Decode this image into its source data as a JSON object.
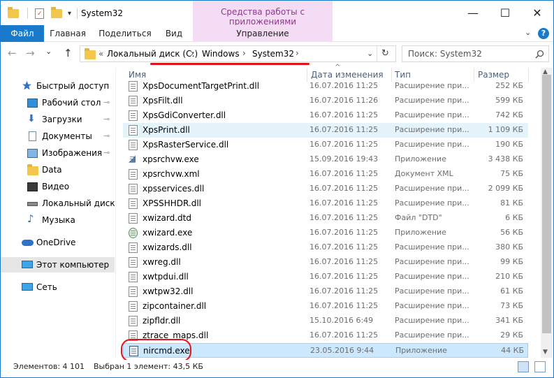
{
  "window": {
    "title": "System32",
    "context_tab_title": "Средства работы с приложениями",
    "min_glyph": "—",
    "max_glyph": "☐",
    "close_glyph": "✕"
  },
  "ribbon": {
    "file": "Файл",
    "home": "Главная",
    "share": "Поделиться",
    "view": "Вид",
    "manage": "Управление",
    "help": "?"
  },
  "nav": {
    "back": "←",
    "forward": "→",
    "dropdown": "⌄",
    "up": "↑",
    "crumb_overflow": "«",
    "crumbs": [
      "Локальный диск (C:)",
      "Windows",
      "System32"
    ],
    "crumb_sep": "›",
    "refresh": "↻",
    "search_placeholder": "Поиск: System32",
    "search_icon": "search-icon"
  },
  "sidebar": {
    "items": [
      {
        "label": "Быстрый доступ",
        "icon": "star-icon",
        "pinned": false
      },
      {
        "label": "Рабочий стол",
        "icon": "desktop-icon",
        "pinned": true
      },
      {
        "label": "Загрузки",
        "icon": "download-icon",
        "pinned": true
      },
      {
        "label": "Документы",
        "icon": "documents-icon",
        "pinned": true
      },
      {
        "label": "Изображения",
        "icon": "pictures-icon",
        "pinned": true
      },
      {
        "label": "Data",
        "icon": "folder-icon",
        "pinned": false
      },
      {
        "label": "Видео",
        "icon": "video-icon",
        "pinned": false
      },
      {
        "label": "Локальный диск (D",
        "icon": "drive-icon",
        "pinned": false
      },
      {
        "label": "Музыка",
        "icon": "music-icon",
        "pinned": false
      },
      {
        "label": "OneDrive",
        "icon": "cloud-icon",
        "pinned": false
      },
      {
        "label": "Этот компьютер",
        "icon": "computer-icon",
        "pinned": false
      },
      {
        "label": "Сеть",
        "icon": "network-icon",
        "pinned": false
      }
    ],
    "pin_glyph": "📌"
  },
  "columns": {
    "name": "Имя",
    "date": "Дата изменения",
    "type": "Тип",
    "size": "Размер"
  },
  "files": [
    {
      "name": "XpsDocumentTargetPrint.dll",
      "date": "16.07.2016 11:25",
      "type": "Расширение при...",
      "size": "252 КБ"
    },
    {
      "name": "XpsFilt.dll",
      "date": "16.07.2016 11:26",
      "type": "Расширение при...",
      "size": "599 КБ"
    },
    {
      "name": "XpsGdiConverter.dll",
      "date": "16.07.2016 11:25",
      "type": "Расширение при...",
      "size": "742 КБ"
    },
    {
      "name": "XpsPrint.dll",
      "date": "16.07.2016 11:25",
      "type": "Расширение при...",
      "size": "1 109 КБ"
    },
    {
      "name": "XpsRasterService.dll",
      "date": "16.07.2016 11:25",
      "type": "Расширение при...",
      "size": "190 КБ"
    },
    {
      "name": "xpsrchvw.exe",
      "date": "15.09.2016 19:43",
      "type": "Приложение",
      "size": "3 438 КБ"
    },
    {
      "name": "xpsrchvw.xml",
      "date": "16.07.2016 11:25",
      "type": "Документ XML",
      "size": "75 КБ"
    },
    {
      "name": "xpsservices.dll",
      "date": "16.07.2016 11:25",
      "type": "Расширение при...",
      "size": "2 099 КБ"
    },
    {
      "name": "XPSSHHDR.dll",
      "date": "16.07.2016 11:25",
      "type": "Расширение при...",
      "size": "81 КБ"
    },
    {
      "name": "xwizard.dtd",
      "date": "16.07.2016 11:25",
      "type": "Файл \"DTD\"",
      "size": "6 КБ"
    },
    {
      "name": "xwizard.exe",
      "date": "16.07.2016 11:25",
      "type": "Приложение",
      "size": "56 КБ"
    },
    {
      "name": "xwizards.dll",
      "date": "16.07.2016 11:25",
      "type": "Расширение при...",
      "size": "380 КБ"
    },
    {
      "name": "xwreg.dll",
      "date": "16.07.2016 11:25",
      "type": "Расширение при...",
      "size": "99 КБ"
    },
    {
      "name": "xwtpdui.dll",
      "date": "16.07.2016 11:25",
      "type": "Расширение при...",
      "size": "210 КБ"
    },
    {
      "name": "xwtpw32.dll",
      "date": "16.07.2016 11:25",
      "type": "Расширение при...",
      "size": "61 КБ"
    },
    {
      "name": "zipcontainer.dll",
      "date": "16.07.2016 11:25",
      "type": "Расширение при...",
      "size": "73 КБ"
    },
    {
      "name": "zipfldr.dll",
      "date": "15.10.2016 6:49",
      "type": "Расширение при...",
      "size": "341 КБ"
    },
    {
      "name": "ztrace_maps.dll",
      "date": "16.07.2016 11:25",
      "type": "Расширение при...",
      "size": "29 КБ"
    },
    {
      "name": "nircmd.exe",
      "date": "23.05.2016 9:44",
      "type": "Приложение",
      "size": "44 КБ"
    }
  ],
  "status": {
    "count": "Элементов: 4 101",
    "selection": "Выбран 1 элемент: 43,5 КБ"
  },
  "colors": {
    "accent": "#1979ca",
    "context_tab": "#f4dcf4",
    "highlight_red": "#e0121b",
    "selection": "#cce8ff"
  }
}
